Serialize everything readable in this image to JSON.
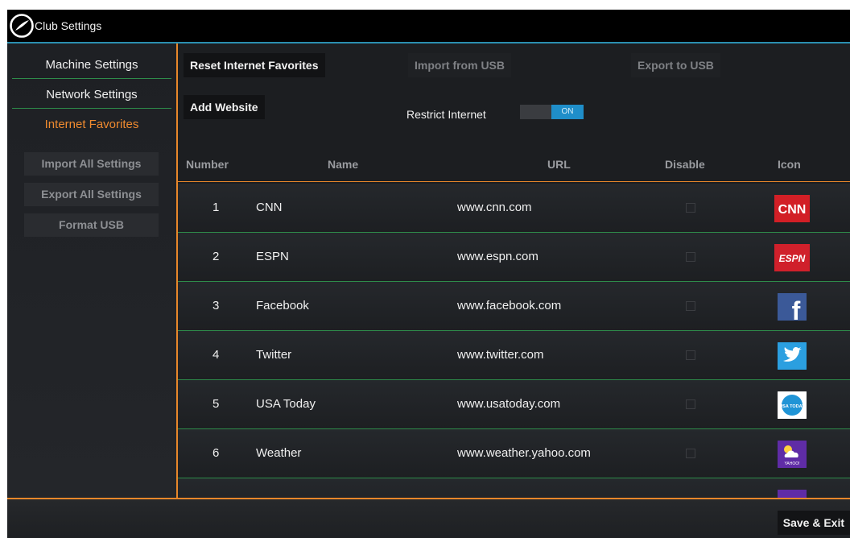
{
  "window": {
    "title": "Club Settings"
  },
  "sidebar": {
    "items": [
      {
        "label": "Machine Settings",
        "active": false
      },
      {
        "label": "Network Settings",
        "active": false
      },
      {
        "label": "Internet Favorites",
        "active": true
      }
    ],
    "buttons": [
      {
        "label": "Import All Settings",
        "enabled": false
      },
      {
        "label": "Export All Settings",
        "enabled": false
      },
      {
        "label": "Format USB",
        "enabled": false
      }
    ]
  },
  "toolbar": {
    "reset_label": "Reset Internet Favorites",
    "import_label": "Import from USB",
    "export_label": "Export to USB",
    "add_label": "Add Website",
    "restrict_label": "Restrict Internet",
    "restrict_state": "ON"
  },
  "table": {
    "headers": {
      "number": "Number",
      "name": "Name",
      "url": "URL",
      "disable": "Disable",
      "icon": "Icon"
    },
    "rows": [
      {
        "number": "1",
        "name": "CNN",
        "url": "www.cnn.com",
        "disabled": false,
        "icon": "cnn-icon",
        "icon_text": "CNN"
      },
      {
        "number": "2",
        "name": "ESPN",
        "url": "www.espn.com",
        "disabled": false,
        "icon": "espn-icon",
        "icon_text": "ESPN"
      },
      {
        "number": "3",
        "name": "Facebook",
        "url": "www.facebook.com",
        "disabled": false,
        "icon": "facebook-icon",
        "icon_text": "f"
      },
      {
        "number": "4",
        "name": "Twitter",
        "url": "www.twitter.com",
        "disabled": false,
        "icon": "twitter-icon",
        "icon_text": ""
      },
      {
        "number": "5",
        "name": "USA Today",
        "url": "www.usatoday.com",
        "disabled": false,
        "icon": "usa-today-icon",
        "icon_text": "USA TODAY"
      },
      {
        "number": "6",
        "name": "Weather",
        "url": "www.weather.yahoo.com",
        "disabled": false,
        "icon": "weather-icon",
        "icon_text": "YAHOO!"
      }
    ]
  },
  "footer": {
    "save_exit_label": "Save & Exit"
  },
  "colors": {
    "accent_orange": "#e8872a",
    "row_divider_green": "#2e8b4a",
    "titlebar_line": "#2b8fb0",
    "toggle_blue": "#1f8ec9"
  }
}
